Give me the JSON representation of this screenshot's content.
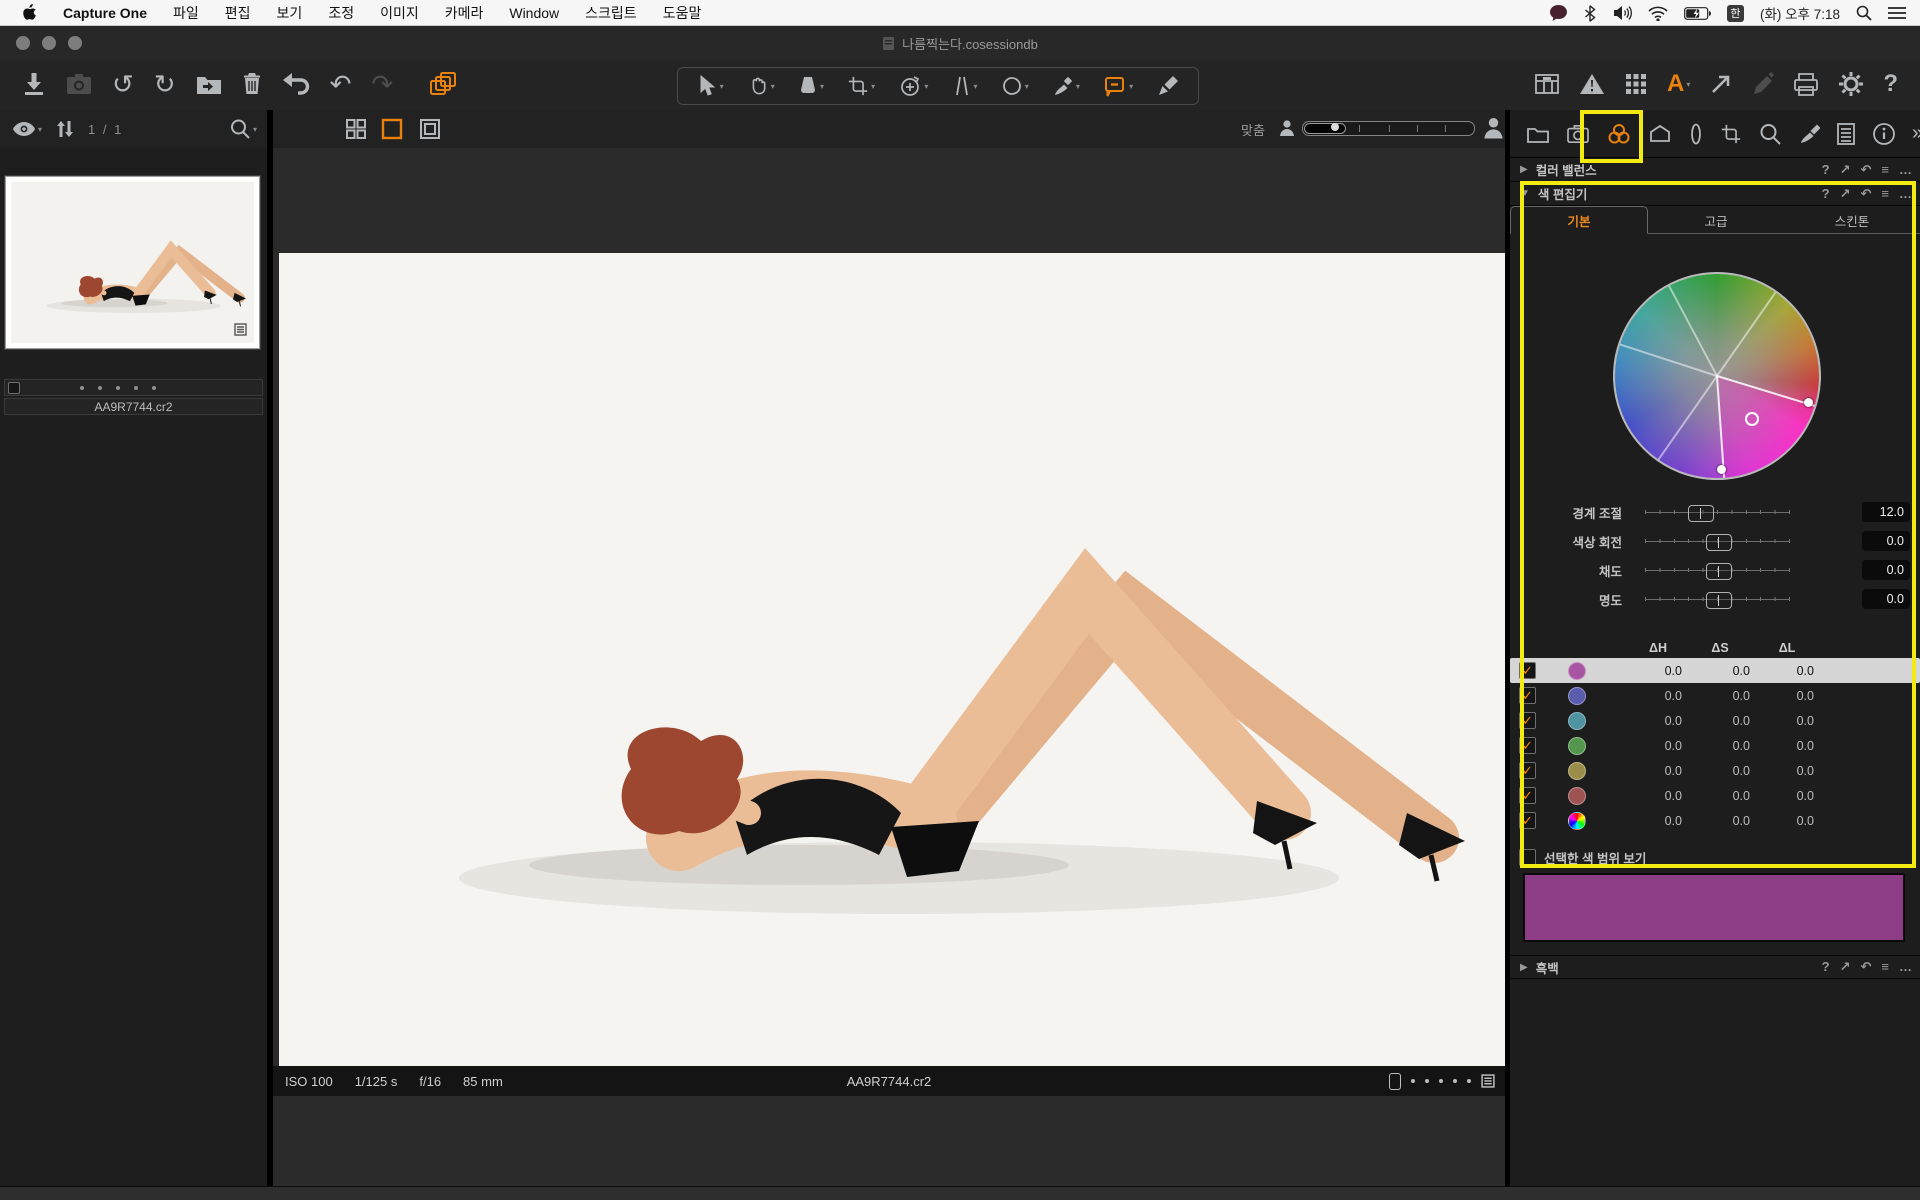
{
  "menubar": {
    "app": "Capture One",
    "items": [
      "파일",
      "편집",
      "보기",
      "조정",
      "이미지",
      "카메라",
      "Window",
      "스크립트",
      "도움말"
    ],
    "status": {
      "korean_input": "한",
      "datetime": "(화) 오후 7:18"
    }
  },
  "window": {
    "title": "나름찍는다.cosessiondb"
  },
  "browser": {
    "count": "1 / 1",
    "filename": "AA9R7744.cr2"
  },
  "viewer": {
    "fit_label": "맞춤",
    "exif": [
      "ISO 100",
      "1/125 s",
      "f/16",
      "85 mm"
    ],
    "filename": "AA9R7744.cr2"
  },
  "sections": {
    "color_balance": "컬러 밸런스",
    "black_white": "흑백"
  },
  "section_icons": {
    "help": "?",
    "expand": "↗",
    "reset": "↶",
    "presets": "≡",
    "more": "…"
  },
  "color_editor": {
    "title": "색 편집기",
    "tabs": [
      "기본",
      "고급",
      "스킨톤"
    ],
    "active_tab": "기본",
    "sliders": [
      {
        "label": "경계 조절",
        "value": "12.0",
        "pos": "38%"
      },
      {
        "label": "색상 회전",
        "value": "0.0",
        "pos": "50%"
      },
      {
        "label": "채도",
        "value": "0.0",
        "pos": "50%"
      },
      {
        "label": "명도",
        "value": "0.0",
        "pos": "50%"
      }
    ],
    "table": {
      "headers": [
        "ΔH",
        "ΔS",
        "ΔL"
      ],
      "rows": [
        {
          "color": "#a755a3",
          "dh": "0.0",
          "ds": "0.0",
          "dl": "0.0",
          "checked": true,
          "selected": true
        },
        {
          "color": "#5c5cac",
          "dh": "0.0",
          "ds": "0.0",
          "dl": "0.0",
          "checked": true
        },
        {
          "color": "#4f93a0",
          "dh": "0.0",
          "ds": "0.0",
          "dl": "0.0",
          "checked": true
        },
        {
          "color": "#55964f",
          "dh": "0.0",
          "ds": "0.0",
          "dl": "0.0",
          "checked": true
        },
        {
          "color": "#9b8d49",
          "dh": "0.0",
          "ds": "0.0",
          "dl": "0.0",
          "checked": true
        },
        {
          "color": "#9e5252",
          "dh": "0.0",
          "ds": "0.0",
          "dl": "0.0",
          "checked": true
        },
        {
          "color": "rainbow",
          "dh": "0.0",
          "ds": "0.0",
          "dl": "0.0",
          "checked": true
        }
      ]
    },
    "range_label": "선택한 색 범위 보기",
    "selected_color_swatch": "#8d3c86",
    "accent": "#e8820c",
    "highlight": "#f2ea10",
    "check_glyph": "✓"
  }
}
